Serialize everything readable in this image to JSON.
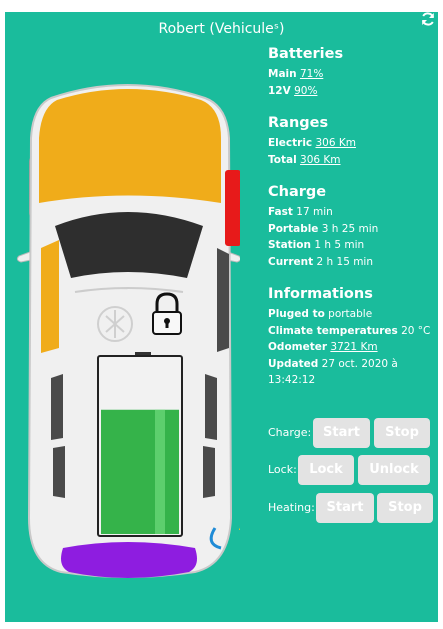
{
  "header": {
    "title": "Robert (Vehiculeˢ)"
  },
  "icons": {
    "refresh": "refresh-icon",
    "lock": "padlock-icon",
    "plug": "charging-plug-icon"
  },
  "colors": {
    "background": "#1abc9c",
    "car_body": "#f0f0f0",
    "windows_front": "#f0ac1a",
    "rear_bumper": "#8e1de0",
    "tail_light": "#e71a1a",
    "battery_fill": "#35b34a",
    "plug": "#1f8bd6",
    "bolt": "#f5d20c"
  },
  "battery_level": 0.71,
  "batteries": {
    "title": "Batteries",
    "main_label": "Main",
    "main_value": "71%",
    "v12_label": "12V",
    "v12_value": "90%"
  },
  "ranges": {
    "title": "Ranges",
    "electric_label": "Electric",
    "electric_value": "306 Km",
    "total_label": "Total",
    "total_value": "306 Km"
  },
  "charge": {
    "title": "Charge",
    "fast_label": "Fast",
    "fast_value": "17 min",
    "portable_label": "Portable",
    "portable_value": "3 h 25 min",
    "station_label": "Station",
    "station_value": "1 h 5 min",
    "current_label": "Current",
    "current_value": "2 h 15 min"
  },
  "informations": {
    "title": "Informations",
    "plugged_label": "Pluged to",
    "plugged_value": "portable",
    "climate_label": "Climate temperatures",
    "climate_value": "20 °C",
    "odometer_label": "Odometer",
    "odometer_value": "3721 Km",
    "updated_label": "Updated",
    "updated_value": "27 oct. 2020 à",
    "updated_value_2": "13:42:12"
  },
  "controls": {
    "charge_label": "Charge:",
    "charge_start": "Start",
    "charge_stop": "Stop",
    "lock_label": "Lock:",
    "lock_lock": "Lock",
    "lock_unlock": "Unlock",
    "heating_label": "Heating:",
    "heating_start": "Start",
    "heating_stop": "Stop"
  }
}
